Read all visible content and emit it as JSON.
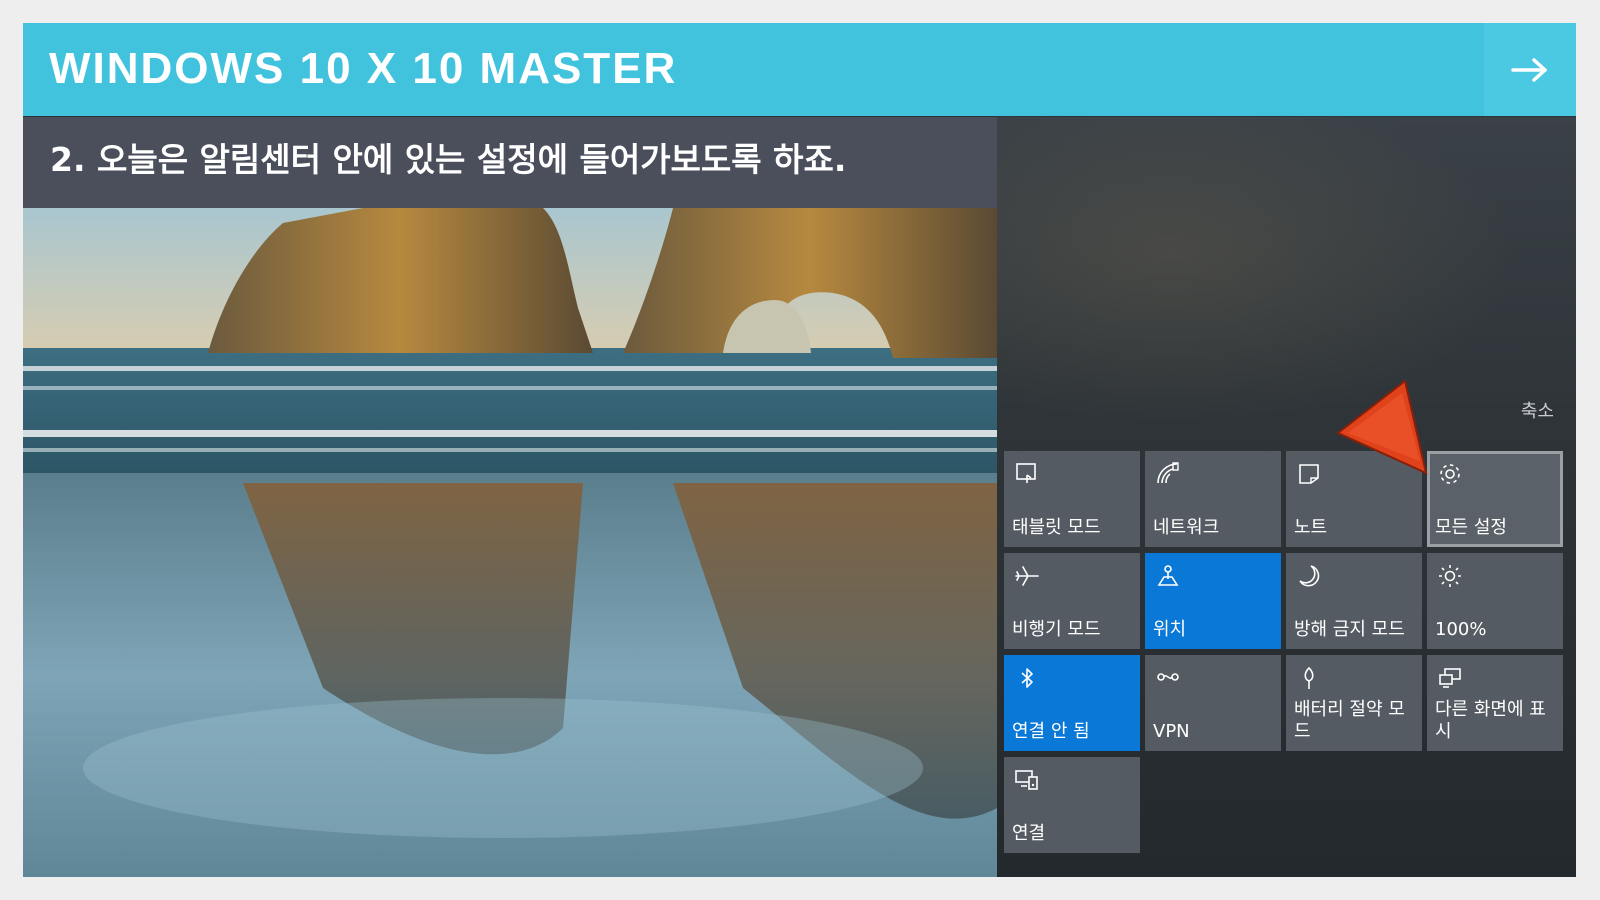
{
  "header": {
    "title": "WINDOWS 10 X 10 MASTER",
    "next_icon": "arrow-right-icon"
  },
  "caption": {
    "text": "2. 오늘은 알림센터 안에 있는 설정에 들어가보도록 하죠."
  },
  "action_center": {
    "collapse_label": "축소",
    "tiles": [
      {
        "label": "태블릿 모드",
        "icon": "tablet-mode-icon",
        "active": false
      },
      {
        "label": "네트워크",
        "icon": "network-icon",
        "active": false
      },
      {
        "label": "노트",
        "icon": "note-icon",
        "active": false
      },
      {
        "label": "모든 설정",
        "icon": "gear-icon",
        "active": false,
        "highlighted": true
      },
      {
        "label": "비행기 모드",
        "icon": "airplane-icon",
        "active": false
      },
      {
        "label": "위치",
        "icon": "location-icon",
        "active": true
      },
      {
        "label": "방해 금지 모드",
        "icon": "moon-icon",
        "active": false
      },
      {
        "label": "100%",
        "icon": "brightness-icon",
        "active": false
      },
      {
        "label": "연결 안 됨",
        "icon": "bluetooth-icon",
        "active": true
      },
      {
        "label": "VPN",
        "icon": "vpn-icon",
        "active": false
      },
      {
        "label": "배터리 절약 모드",
        "icon": "battery-saver-icon",
        "active": false
      },
      {
        "label": "다른 화면에 표시",
        "icon": "project-icon",
        "active": false
      },
      {
        "label": "연결",
        "icon": "connect-icon",
        "active": false
      }
    ]
  },
  "colors": {
    "header": "#41c3de",
    "caption_bar": "#4a4f5b",
    "tile": "#545b62",
    "tile_active": "#0a78d7",
    "pointer": "#e0431c"
  }
}
